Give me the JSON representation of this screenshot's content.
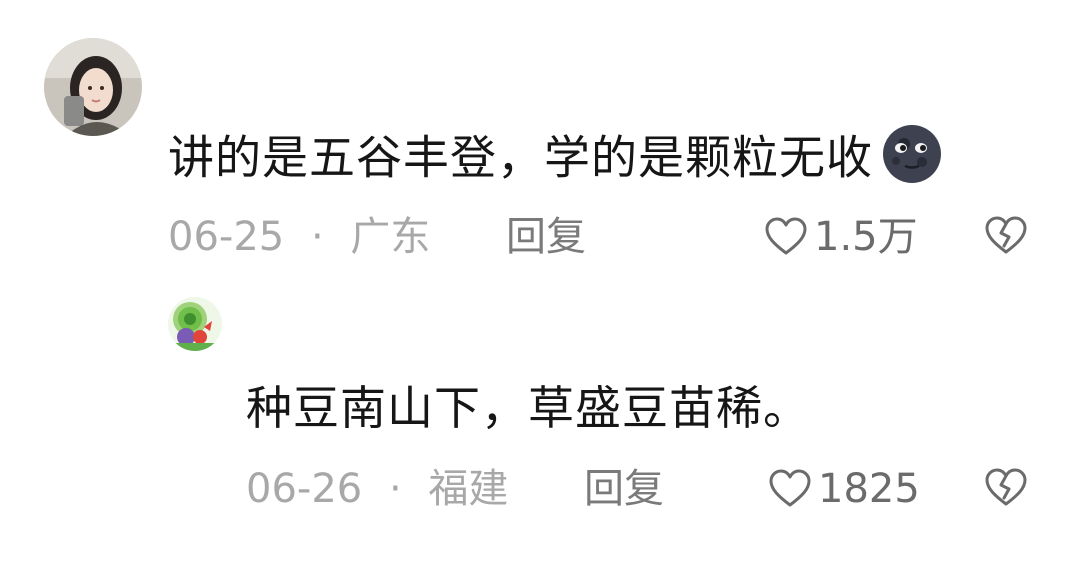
{
  "comments": [
    {
      "avatar_icon": "user-avatar-woman-photo",
      "text": "讲的是五谷丰登，学的是颗粒无收",
      "emoji_icon": "new-moon-face-emoji",
      "date": "06-25",
      "separator": "·",
      "location": "广东",
      "reply_label": "回复",
      "like_count": "1.5万"
    },
    {
      "avatar_icon": "user-avatar-cartoon-peacock",
      "text": "种豆南山下，草盛豆苗稀。",
      "date": "06-26",
      "separator": "·",
      "location": "福建",
      "reply_label": "回复",
      "like_count": "1825"
    }
  ],
  "icons": {
    "like": "heart-outline-icon",
    "dislike": "broken-heart-icon"
  },
  "colors": {
    "text": "#161616",
    "meta": "#a8a8a8",
    "reply": "#7a7a7a",
    "icon": "#6b6b6b"
  }
}
